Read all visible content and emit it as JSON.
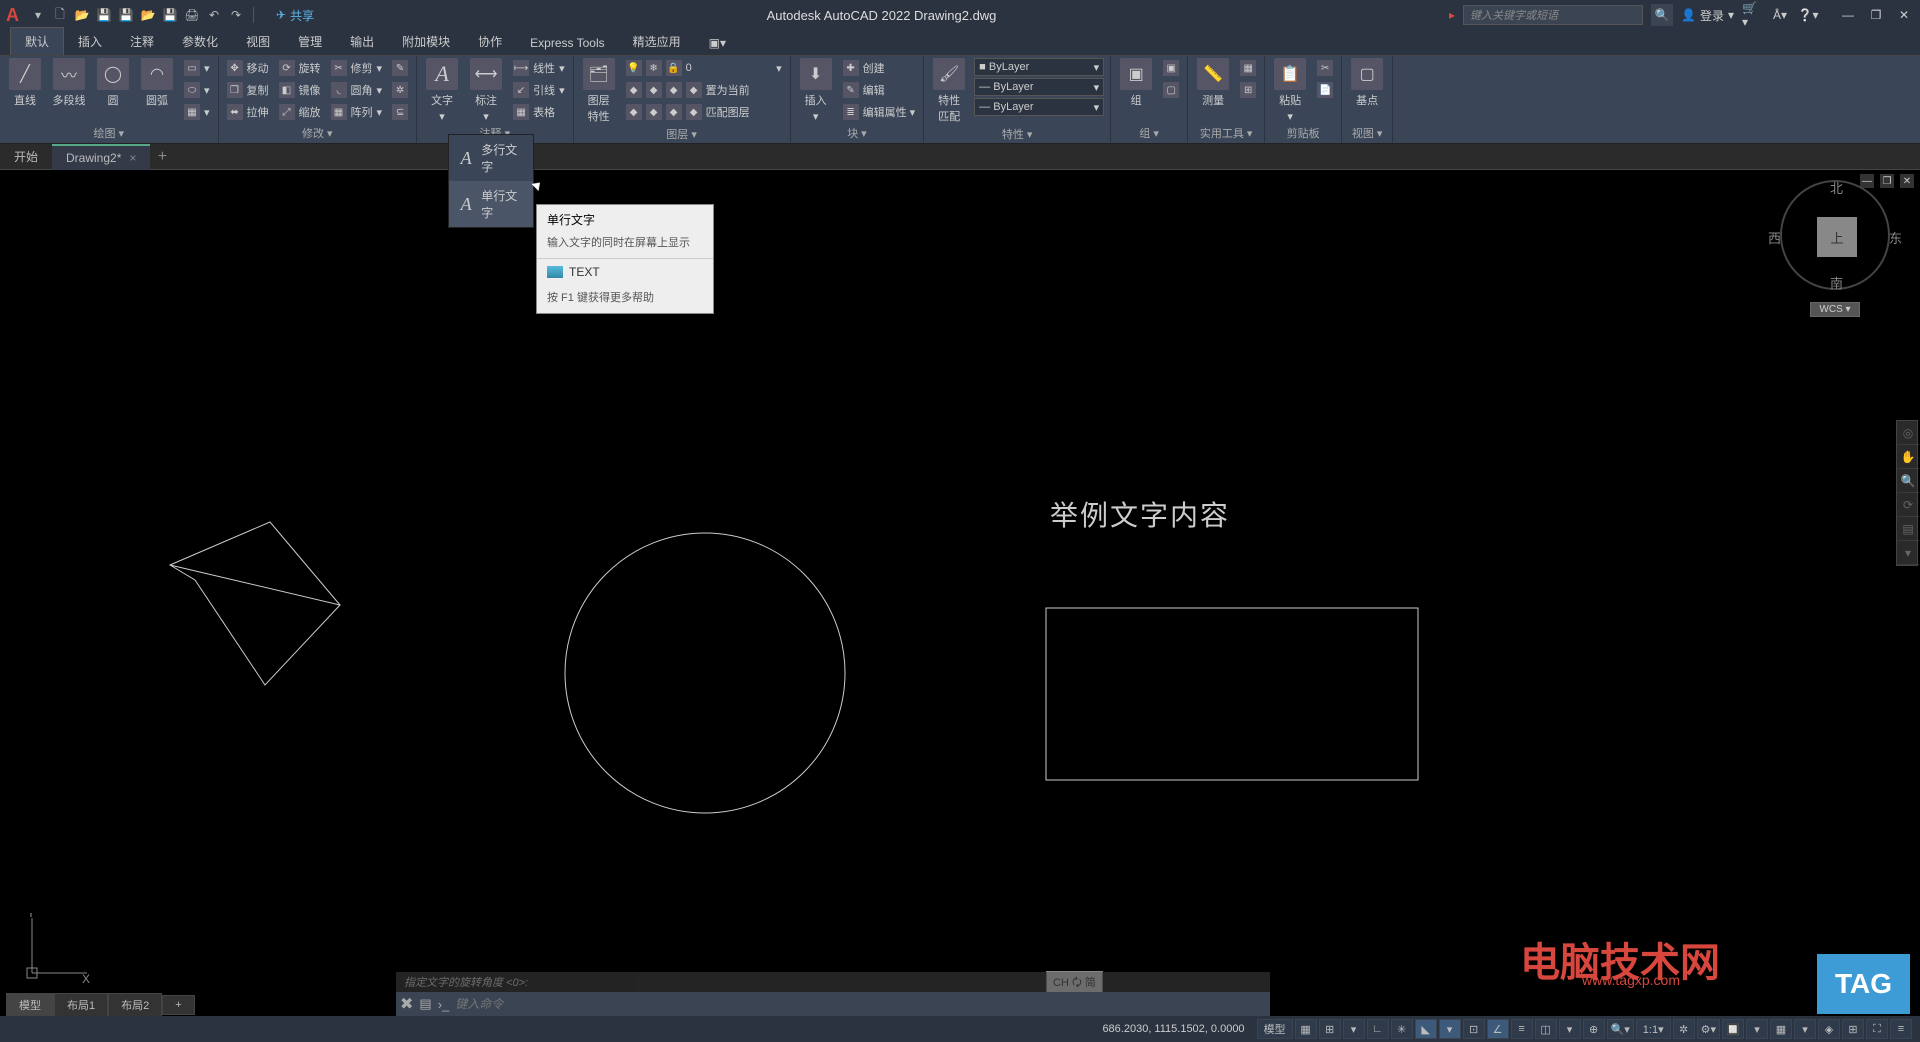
{
  "titlebar": {
    "share": "共享",
    "title": "Autodesk AutoCAD 2022   Drawing2.dwg",
    "search_placeholder": "键入关键字或短语",
    "signin": "登录"
  },
  "menutabs": [
    "默认",
    "插入",
    "注释",
    "参数化",
    "视图",
    "管理",
    "输出",
    "附加模块",
    "协作",
    "Express Tools",
    "精选应用"
  ],
  "ribbon": {
    "draw": {
      "line": "直线",
      "polyline": "多段线",
      "circle": "圆",
      "arc": "圆弧",
      "title": "绘图 ▾"
    },
    "modify": {
      "r1": [
        "移动",
        "旋转",
        "修剪"
      ],
      "r2": [
        "复制",
        "镜像",
        "圆角"
      ],
      "r3": [
        "拉伸",
        "缩放",
        "阵列"
      ],
      "title": "修改 ▾"
    },
    "annotate": {
      "text": "文字",
      "dim": "标注",
      "linear": "线性",
      "leader": "引线",
      "table": "表格",
      "title": "注释 ▾"
    },
    "layers": {
      "props": "图层\n特性",
      "r1": "置为当前",
      "r2": "匹配图层",
      "title": "图层 ▾"
    },
    "block": {
      "insert": "插入",
      "create": "创建",
      "edit": "编辑",
      "editattr": "编辑属性 ▾",
      "title": "块 ▾"
    },
    "props": {
      "match": "特性\n匹配",
      "byLayer": "ByLayer",
      "title": "特性 ▾"
    },
    "group": {
      "group": "组",
      "title": "组 ▾"
    },
    "util": {
      "measure": "测量",
      "title": "实用工具 ▾"
    },
    "clip": {
      "paste": "粘贴",
      "title": "剪贴板"
    },
    "view": {
      "base": "基点",
      "title": "视图 ▾"
    }
  },
  "doctabs": {
    "start": "开始",
    "drawing": "Drawing2*"
  },
  "dropdown": {
    "mtext": "多行文字",
    "dtext": "单行文字"
  },
  "tooltip": {
    "title": "单行文字",
    "desc": "输入文字的同时在屏幕上显示",
    "cmd": "TEXT",
    "f1": "按 F1 键获得更多帮助"
  },
  "canvas": {
    "sample_text": "举例文字内容"
  },
  "viewcube": {
    "top": "上",
    "n": "北",
    "s": "南",
    "e": "东",
    "w": "西",
    "wcs": "WCS ▾"
  },
  "ucs": {
    "x": "X",
    "y": "Y"
  },
  "cmd": {
    "history": "指定文字的旋转角度 <0>:",
    "placeholder": "键入命令"
  },
  "modeltabs": {
    "model": "模型",
    "l1": "布局1",
    "l2": "布局2",
    "plus": "+"
  },
  "status": {
    "coords": "686.2030, 1115.1502, 0.0000",
    "model": "模型",
    "ime": "CH 🗘 简"
  },
  "watermark": {
    "cn": "电脑技术网",
    "url": "www.tagxp.com",
    "tag": "TAG"
  }
}
